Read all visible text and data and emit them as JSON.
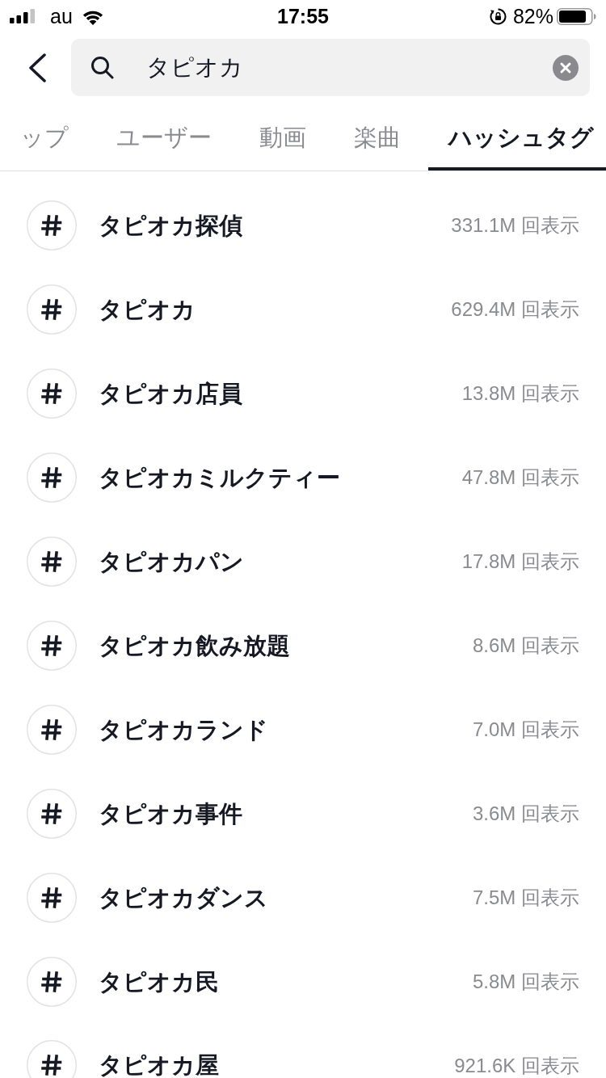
{
  "status_bar": {
    "carrier": "au",
    "time": "17:55",
    "battery": "82%"
  },
  "search": {
    "value": "タピオカ"
  },
  "tabs": [
    {
      "label": "ップ",
      "selected": false
    },
    {
      "label": "ユーザー",
      "selected": false
    },
    {
      "label": "動画",
      "selected": false
    },
    {
      "label": "楽曲",
      "selected": false
    },
    {
      "label": "ハッシュタグ",
      "selected": true
    }
  ],
  "hashtags": [
    {
      "name": "タピオカ探偵",
      "views": "331.1M 回表示"
    },
    {
      "name": "タピオカ",
      "views": "629.4M 回表示"
    },
    {
      "name": "タピオカ店員",
      "views": "13.8M 回表示"
    },
    {
      "name": "タピオカミルクティー",
      "views": "47.8M 回表示"
    },
    {
      "name": "タピオカパン",
      "views": "17.8M 回表示"
    },
    {
      "name": "タピオカ飲み放題",
      "views": "8.6M 回表示"
    },
    {
      "name": "タピオカランド",
      "views": "7.0M 回表示"
    },
    {
      "name": "タピオカ事件",
      "views": "3.6M 回表示"
    },
    {
      "name": "タピオカダンス",
      "views": "7.5M 回表示"
    },
    {
      "name": "タピオカ民",
      "views": "5.8M 回表示"
    },
    {
      "name": "タピオカ屋",
      "views": "921.6K 回表示"
    }
  ]
}
